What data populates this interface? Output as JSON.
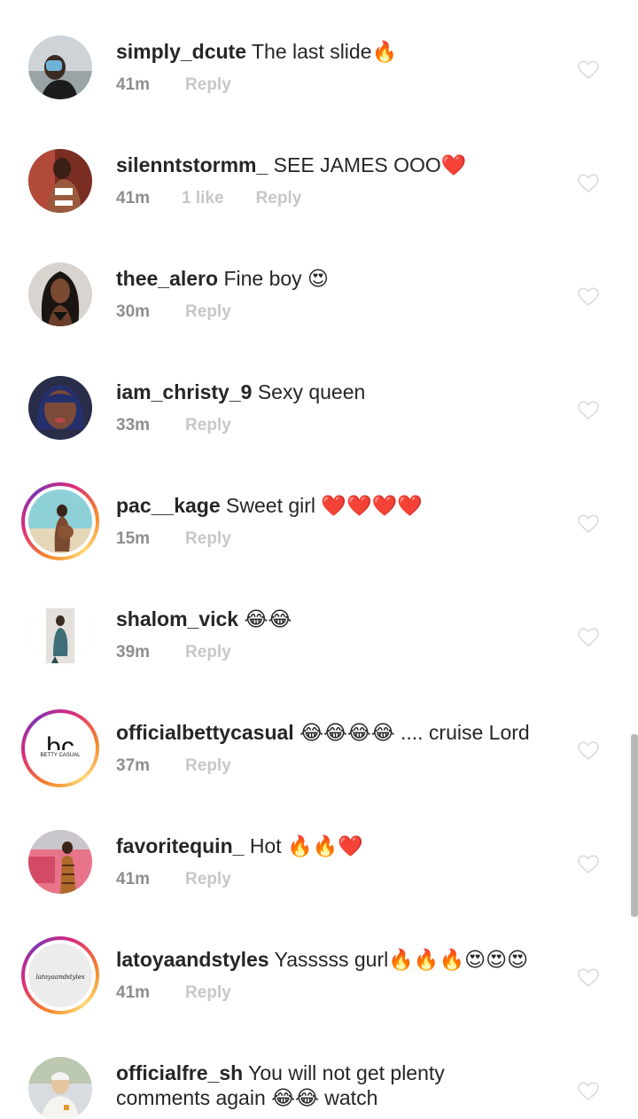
{
  "colors": {
    "text": "#262626",
    "meta": "#8e8e8e",
    "meta_light": "#c7c7c7",
    "heart_outline": "#dbdbdb",
    "story_ring": [
      "#f58529",
      "#dd2a7b",
      "#8134af",
      "#feda77"
    ]
  },
  "comments": [
    {
      "username": "simply_dcute",
      "text": "The last slide🔥",
      "time": "41m",
      "likes": "",
      "reply": "Reply",
      "story_ring": false,
      "avatar": "profile-photo"
    },
    {
      "username": "silenntstormm_",
      "text": "SEE JAMES OOO❤️",
      "time": "41m",
      "likes": "1 like",
      "reply": "Reply",
      "story_ring": false,
      "avatar": "profile-photo"
    },
    {
      "username": "thee_alero",
      "text": "Fine boy 😍",
      "time": "30m",
      "likes": "",
      "reply": "Reply",
      "story_ring": false,
      "avatar": "profile-photo"
    },
    {
      "username": "iam_christy_9",
      "text": "Sexy queen",
      "time": "33m",
      "likes": "",
      "reply": "Reply",
      "story_ring": false,
      "avatar": "profile-photo"
    },
    {
      "username": "pac__kage",
      "text": "Sweet girl ❤️❤️❤️❤️",
      "time": "15m",
      "likes": "",
      "reply": "Reply",
      "story_ring": true,
      "avatar": "profile-photo"
    },
    {
      "username": "shalom_vick",
      "text": "😂😂",
      "time": "39m",
      "likes": "",
      "reply": "Reply",
      "story_ring": false,
      "avatar": "profile-photo"
    },
    {
      "username": "officialbettycasual",
      "text": "😂😂😂😂 .... cruise Lord",
      "time": "37m",
      "likes": "",
      "reply": "Reply",
      "story_ring": true,
      "avatar": "bc-logo"
    },
    {
      "username": "favoritequin_",
      "text": "Hot 🔥🔥❤️",
      "time": "41m",
      "likes": "",
      "reply": "Reply",
      "story_ring": false,
      "avatar": "profile-photo"
    },
    {
      "username": "latoyaandstyles",
      "text": "Yasssss gurl🔥🔥🔥😍😍😍",
      "time": "41m",
      "likes": "",
      "reply": "Reply",
      "story_ring": true,
      "avatar": "script-logo"
    },
    {
      "username": "officialfre_sh",
      "text": "You will not get plenty comments again 😂😂 watch",
      "time": "",
      "likes": "",
      "reply": "",
      "story_ring": false,
      "avatar": "profile-photo"
    }
  ],
  "logos": {
    "bc_mark": "bc",
    "bc_word": "BETTY CASUAL",
    "script_word": "latoyaandstyles"
  }
}
